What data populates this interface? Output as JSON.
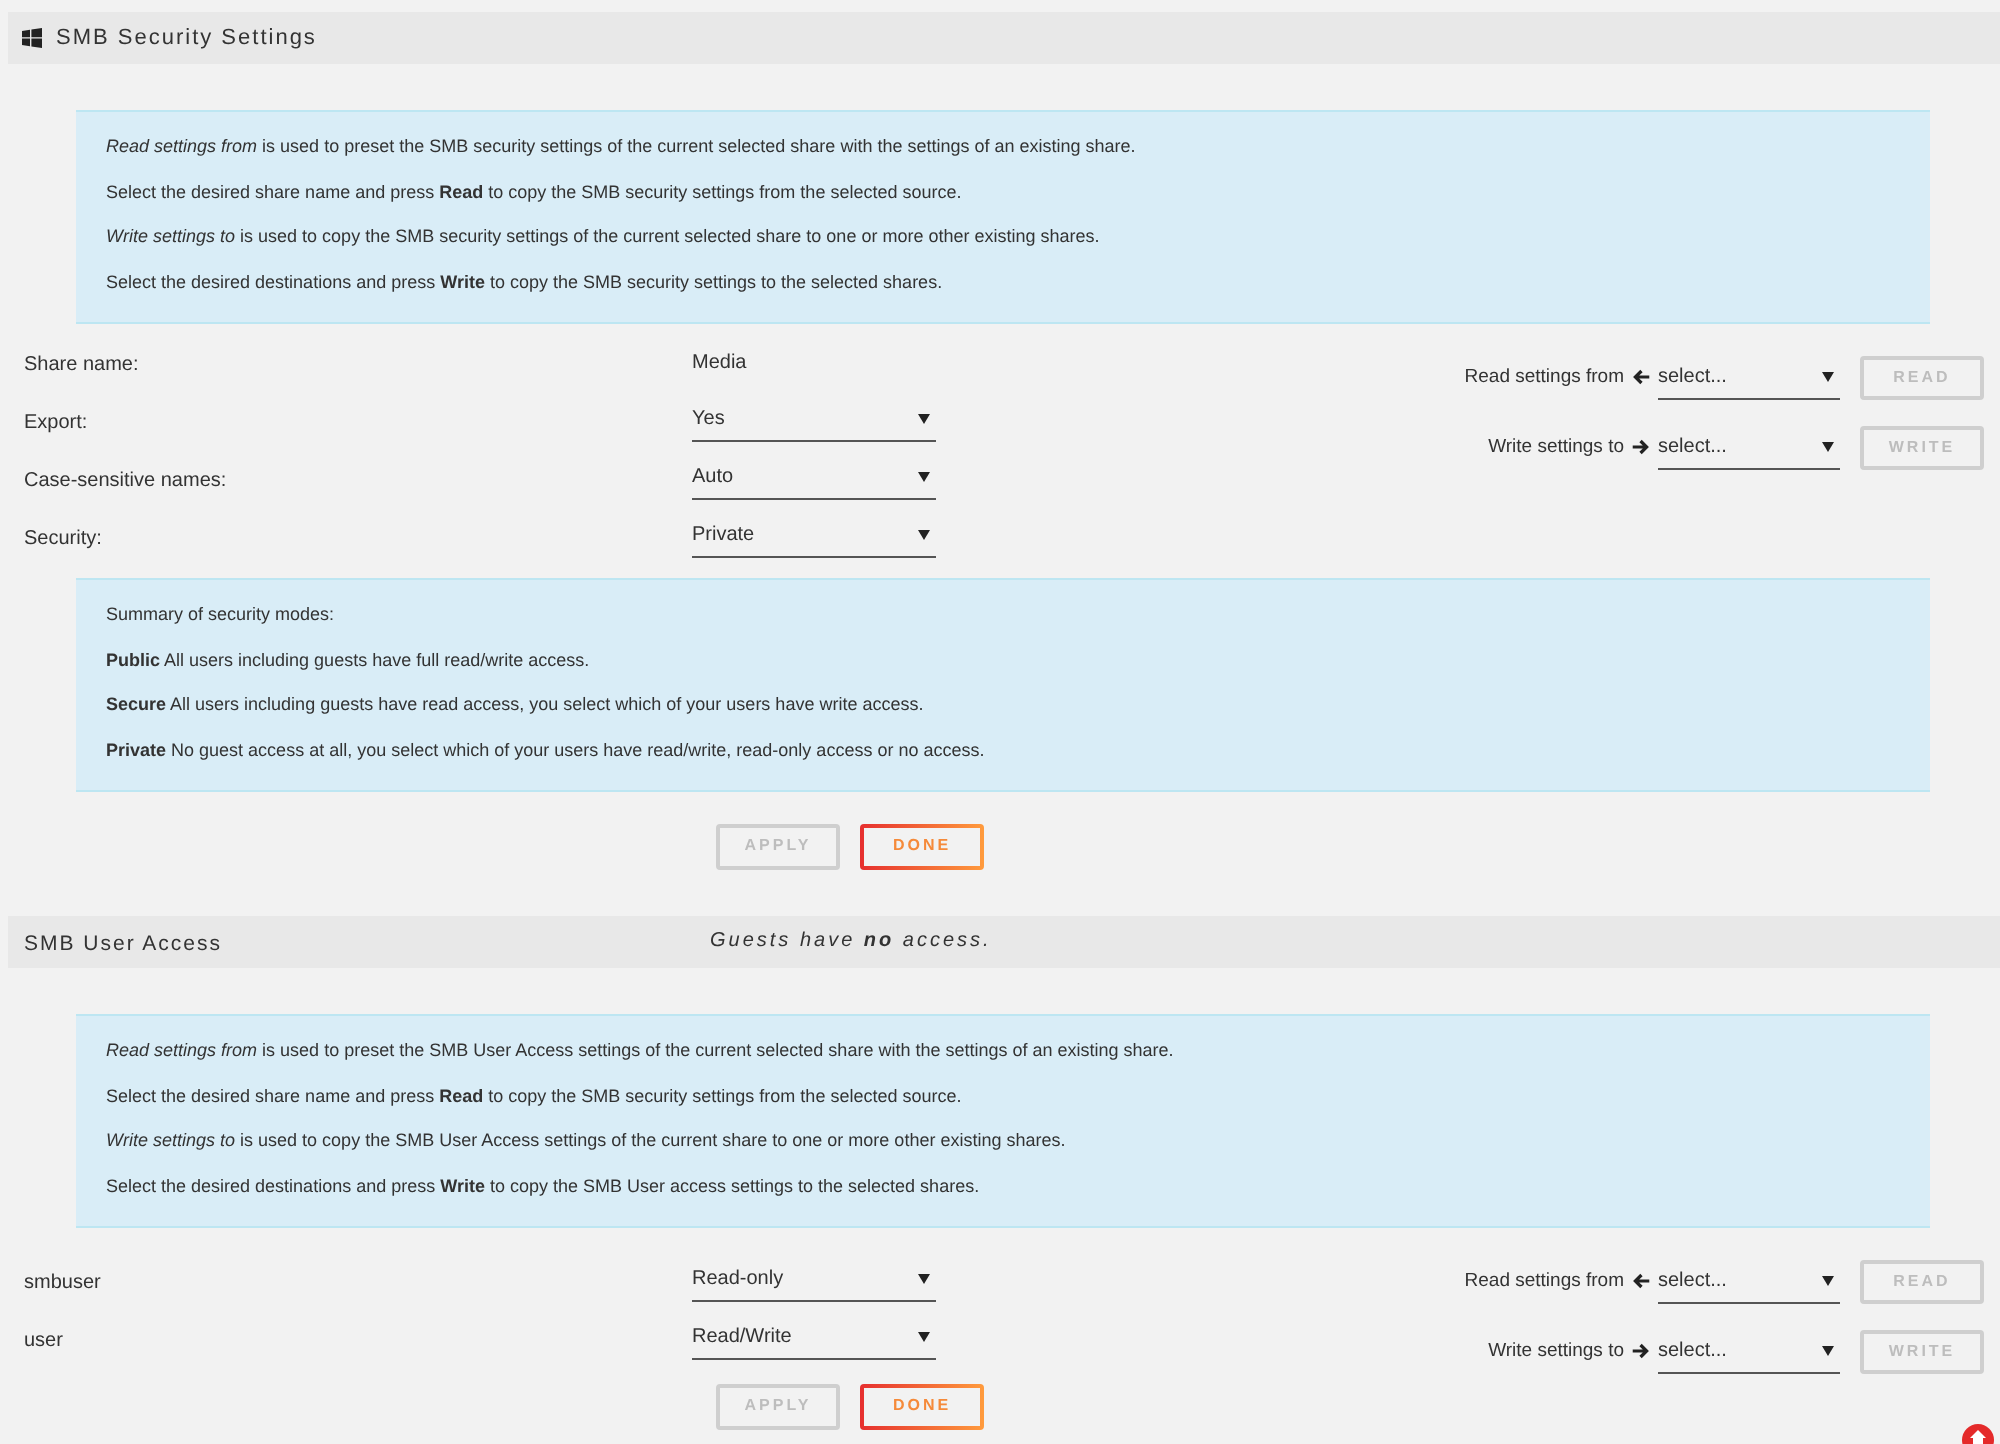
{
  "security_settings": {
    "title": "SMB Security Settings",
    "info": [
      "*Read settings from* is used to preset the SMB security settings of the current selected share with the settings of an existing share.",
      "Select the desired share name and press **Read** to copy the SMB security settings from the selected source.",
      "*Write settings to* is used to copy the SMB security settings of the current selected share to one or more other existing shares.",
      "Select the desired destinations and press **Write** to copy the SMB security settings to the selected shares."
    ],
    "fields": [
      {
        "label": "Share name:",
        "kind": "text",
        "value": "Media"
      },
      {
        "label": "Export:",
        "kind": "select",
        "value": "Yes"
      },
      {
        "label": "Case-sensitive names:",
        "kind": "select",
        "value": "Auto"
      },
      {
        "label": "Security:",
        "kind": "select",
        "value": "Private"
      }
    ],
    "copy_controls": [
      {
        "kind": "read",
        "label": "Read settings from",
        "value": "select...",
        "button": {
          "label": "READ",
          "disabled": true
        }
      },
      {
        "kind": "write",
        "label": "Write settings to",
        "value": "select...",
        "button": {
          "label": "WRITE",
          "disabled": true
        }
      }
    ],
    "summary": [
      "Summary of security modes:",
      "**Public** All users including guests have full read/write access.",
      "**Secure** All users including guests have read access, you select which of your users have write access.",
      "**Private** No guest access at all, you select which of your users have read/write, read-only access or no access."
    ],
    "buttons": [
      {
        "label": "APPLY",
        "disabled": true
      },
      {
        "label": "DONE",
        "disabled": false
      }
    ]
  },
  "user_access": {
    "title": "SMB User Access",
    "note": "Guests have **no** access.",
    "info": [
      "*Read settings from* is used to preset the SMB User Access settings of the current selected share with the settings of an existing share.",
      "Select the desired share name and press **Read** to copy the SMB security settings from the selected source.",
      "*Write settings to* is used to copy the SMB User Access settings of the current share to one or more other existing shares.",
      "Select the desired destinations and press **Write** to copy the SMB User access settings to the selected shares."
    ],
    "users": [
      {
        "name": "smbuser",
        "access": "Read-only"
      },
      {
        "name": "user",
        "access": "Read/Write"
      }
    ],
    "copy_controls": [
      {
        "kind": "read",
        "label": "Read settings from",
        "value": "select...",
        "button": {
          "label": "READ",
          "disabled": true
        }
      },
      {
        "kind": "write",
        "label": "Write settings to",
        "value": "select...",
        "button": {
          "label": "WRITE",
          "disabled": true
        }
      }
    ],
    "buttons": [
      {
        "label": "APPLY",
        "disabled": true
      },
      {
        "label": "DONE",
        "disabled": false
      }
    ]
  }
}
